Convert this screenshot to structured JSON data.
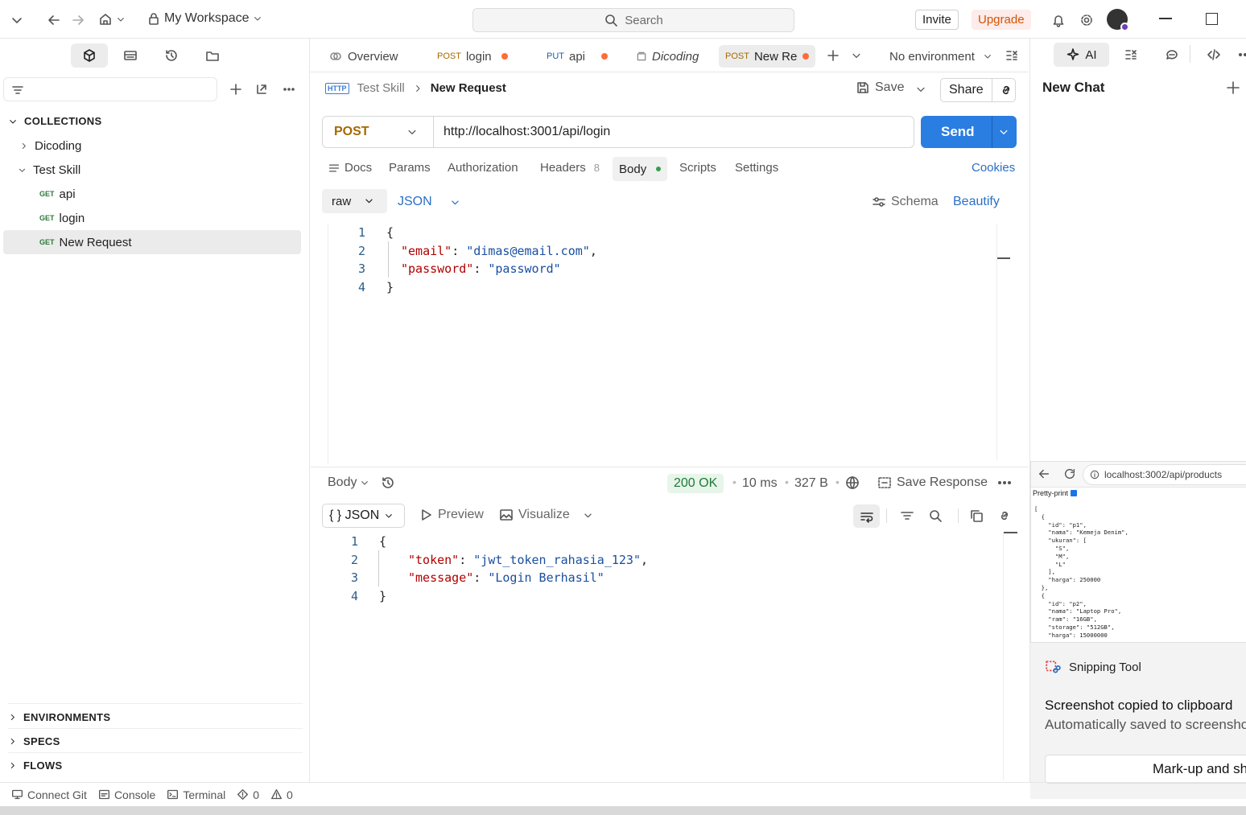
{
  "topbar": {
    "workspace": "My Workspace",
    "search_placeholder": "Search",
    "invite": "Invite",
    "upgrade": "Upgrade"
  },
  "sidebar": {
    "collections_label": "COLLECTIONS",
    "tree": [
      {
        "label": "Dicoding",
        "type": "folder",
        "expanded": false
      },
      {
        "label": "Test Skill",
        "type": "folder",
        "expanded": true
      },
      {
        "label": "api",
        "type": "request",
        "method": "GET"
      },
      {
        "label": "login",
        "type": "request",
        "method": "GET"
      },
      {
        "label": "New Request",
        "type": "request",
        "method": "GET",
        "selected": true
      }
    ],
    "sections": [
      "ENVIRONMENTS",
      "SPECS",
      "FLOWS"
    ]
  },
  "tabs": [
    {
      "label": "Overview",
      "method": ""
    },
    {
      "label": "login",
      "method": "POST",
      "unsaved": true
    },
    {
      "label": "api",
      "method": "PUT",
      "unsaved": true
    },
    {
      "label": "Dicoding",
      "method": ""
    },
    {
      "label": "New Rec",
      "method": "POST",
      "unsaved": true,
      "active": true
    }
  ],
  "environment": "No environment",
  "breadcrumb": {
    "parent": "Test Skill",
    "current": "New Request"
  },
  "request": {
    "save": "Save",
    "share": "Share",
    "method": "POST",
    "url": "http://localhost:3001/api/login",
    "send": "Send",
    "tabs": {
      "docs": "Docs",
      "params": "Params",
      "authorization": "Authorization",
      "headers": "Headers",
      "headers_count": "8",
      "body": "Body",
      "scripts": "Scripts",
      "settings": "Settings",
      "cookies": "Cookies"
    },
    "body_mode": "raw",
    "body_type": "JSON",
    "schema": "Schema",
    "beautify": "Beautify",
    "code": {
      "email_key": "\"email\"",
      "email_val": "\"dimas@email.com\"",
      "password_key": "\"password\"",
      "password_val": "\"password\""
    }
  },
  "response": {
    "body_label": "Body",
    "status": "200 OK",
    "time": "10 ms",
    "size": "327 B",
    "save_response": "Save Response",
    "format": "{ } JSON",
    "preview": "Preview",
    "visualize": "Visualize",
    "code": {
      "token_key": "\"token\"",
      "token_val": "\"jwt_token_rahasia_123\"",
      "message_key": "\"message\"",
      "message_val": "\"Login Berhasil\""
    }
  },
  "right_panel": {
    "ai": "AI",
    "title": "New Chat"
  },
  "browser_overlay": {
    "url": "localhost:3002/api/products",
    "pretty_print": "Pretty-print",
    "json_lines": [
      "[",
      "  {",
      "    \"id\": \"p1\",",
      "    \"nama\": \"Kemeja Denim\",",
      "    \"ukuran\": [",
      "      \"S\",",
      "      \"M\",",
      "      \"L\"",
      "    ],",
      "    \"harga\": 250000",
      "  },",
      "  {",
      "    \"id\": \"p2\",",
      "    \"nama\": \"Laptop Pro\",",
      "    \"ram\": \"16GB\",",
      "    \"storage\": \"512GB\",",
      "    \"harga\": 15000000"
    ]
  },
  "snipping": {
    "app": "Snipping Tool",
    "title": "Screenshot copied to clipboard",
    "subtitle": "Automatically saved to screensho",
    "button": "Mark-up and sh"
  },
  "statusbar": {
    "connect_git": "Connect Git",
    "console": "Console",
    "terminal": "Terminal",
    "errors": "0",
    "warnings": "0"
  }
}
